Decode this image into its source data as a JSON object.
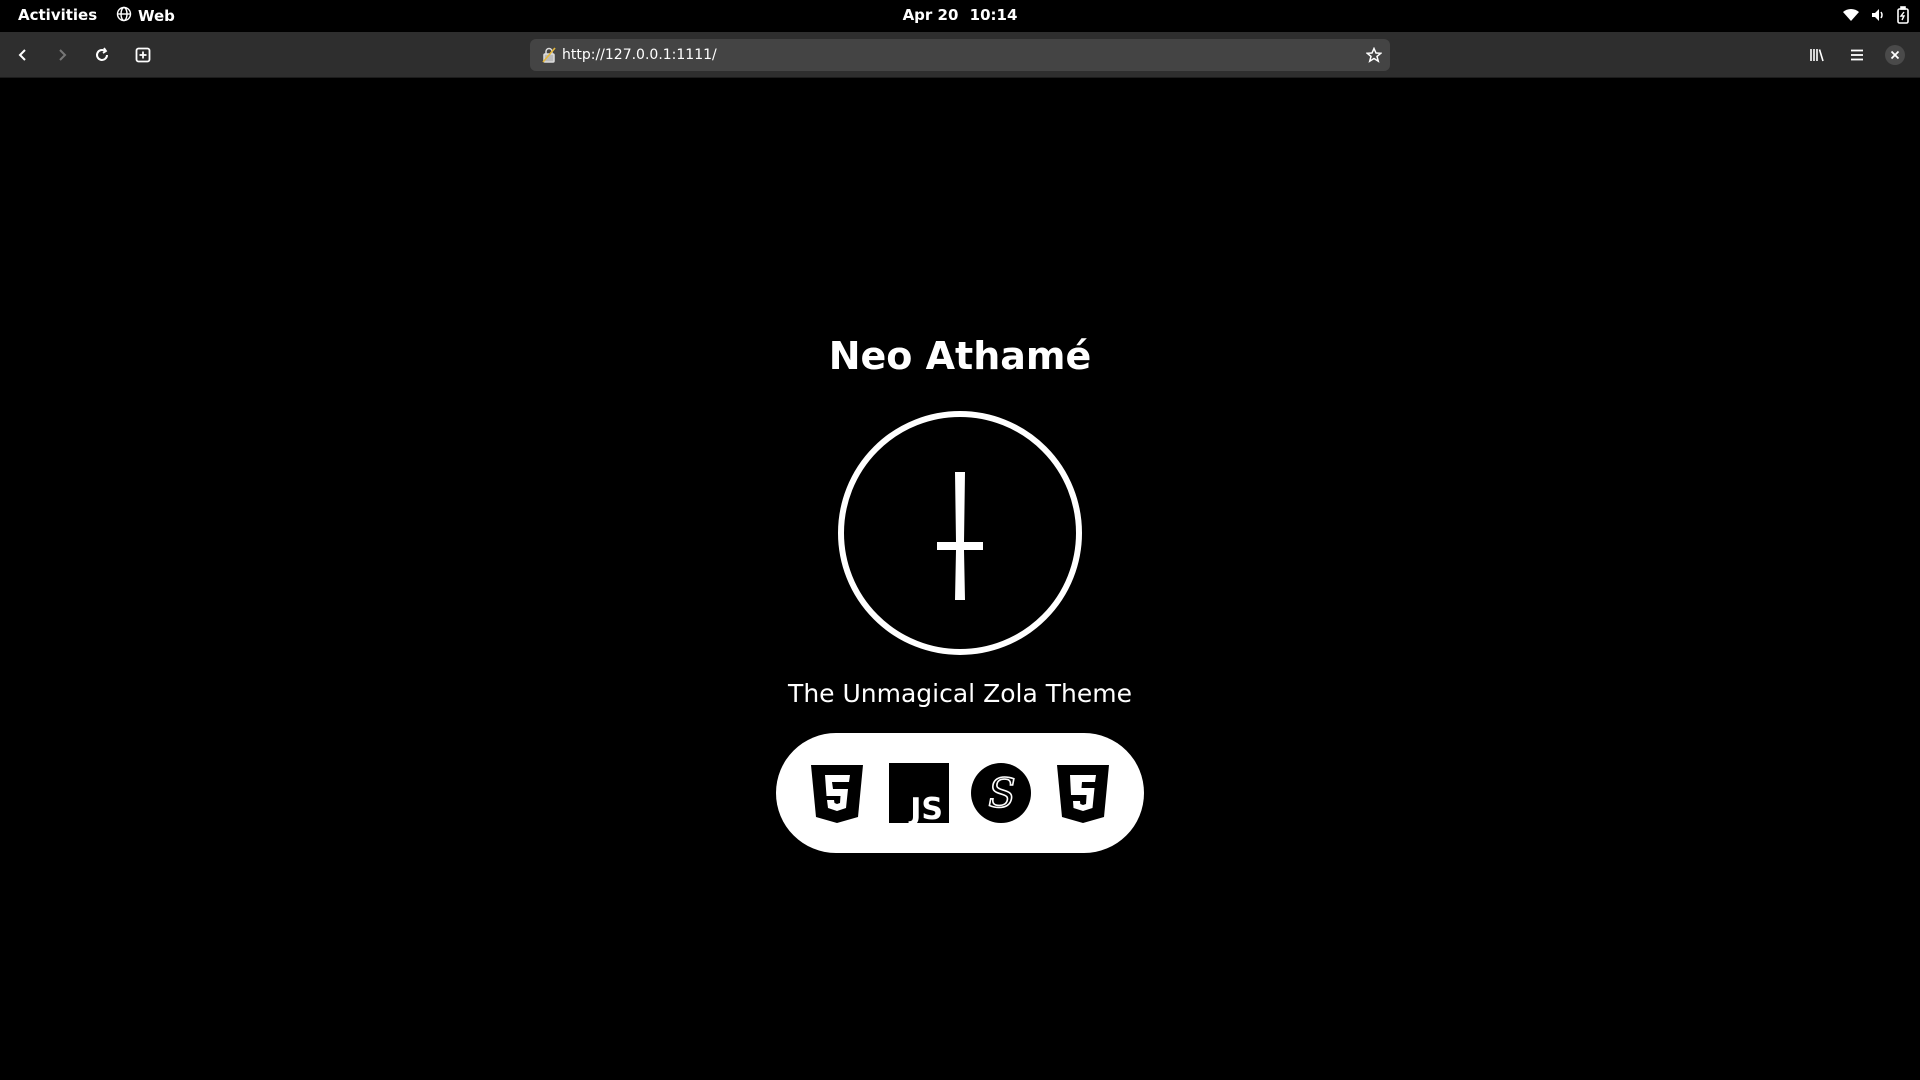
{
  "topbar": {
    "activities": "Activities",
    "app_name": "Web",
    "date": "Apr 20",
    "time": "10:14",
    "tray_icons": [
      "wifi-icon",
      "volume-icon",
      "battery-icon"
    ]
  },
  "browser": {
    "url": "http://127.0.0.1:1111/",
    "buttons": [
      "back",
      "forward",
      "reload",
      "new-tab",
      "bookmark",
      "library",
      "menu",
      "close"
    ]
  },
  "page": {
    "title": "Neo Athamé",
    "tagline": "The Unmagical Zola Theme",
    "tech_icons": [
      "html5-icon",
      "javascript-icon",
      "sass-icon",
      "css3-icon"
    ],
    "logo_letters": {
      "js": "JS",
      "sass": "S"
    }
  },
  "colors": {
    "background": "#000000",
    "foreground": "#ffffff",
    "toolbar": "#2e2e2e",
    "urlbar": "#444444"
  }
}
